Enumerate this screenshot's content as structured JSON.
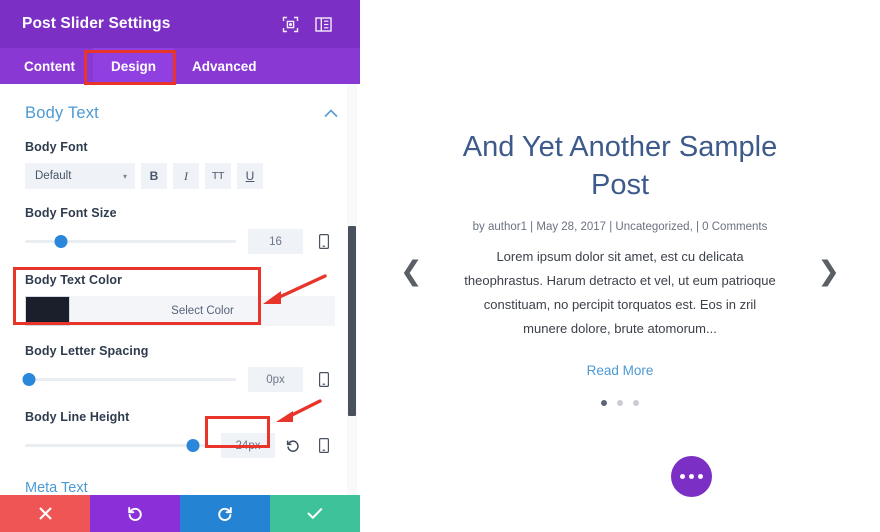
{
  "panel": {
    "title": "Post Slider Settings",
    "header_icons": [
      {
        "name": "focus-target-icon"
      },
      {
        "name": "layout-panel-icon"
      }
    ],
    "tabs": [
      {
        "label": "Content",
        "active": false
      },
      {
        "label": "Design",
        "active": true
      },
      {
        "label": "Advanced",
        "active": false
      }
    ],
    "section": {
      "title": "Body Text",
      "collapse_icon": "chevron-up-icon"
    },
    "fields": {
      "body_font": {
        "label": "Body Font",
        "value": "Default",
        "caret": "▾",
        "style_buttons": [
          "B",
          "I",
          "TT",
          "U"
        ]
      },
      "body_font_size": {
        "label": "Body Font Size",
        "value": "16",
        "knob_percent": 17
      },
      "body_text_color": {
        "label": "Body Text Color",
        "swatch_hex": "#1b1f2c",
        "button_label": "Select Color"
      },
      "body_letter_spacing": {
        "label": "Body Letter Spacing",
        "value": "0px",
        "knob_percent": 2
      },
      "body_line_height": {
        "label": "Body Line Height",
        "value": "24px",
        "knob_percent": 91,
        "reset_icon": "undo-reset-icon"
      }
    },
    "next_section_peek": "Meta Text",
    "action_bar": [
      {
        "name": "close",
        "glyph": "✕"
      },
      {
        "name": "undo",
        "glyph": "↺"
      },
      {
        "name": "redo",
        "glyph": "↻"
      },
      {
        "name": "save",
        "glyph": "✔"
      }
    ],
    "colors": {
      "header": "#7b2fc4",
      "tabbar": "#8a38d4",
      "tab_active": "#9040e0",
      "section_title": "#4c9ad4",
      "slider_knob": "#2b87da",
      "annotation": "#e8342a",
      "act_close": "#f05555",
      "act_undo": "#8b30d9",
      "act_redo": "#2583d4",
      "act_save": "#3ec29a"
    }
  },
  "preview": {
    "post_title": "And Yet Another Sample Post",
    "post_meta": "by author1 | May 28, 2017 | Uncategorized, | 0 Comments",
    "post_excerpt": "Lorem ipsum dolor sit amet, est cu delicata theophrastus. Harum detracto et vel, ut eum patrioque constituam, no percipit torquatos est. Eos in zril munere dolore, brute atomorum...",
    "read_more": "Read More",
    "prev_arrow": "❮",
    "next_arrow": "❯",
    "dots": [
      true,
      false,
      false
    ],
    "fab_icon": "three-dots-icon"
  }
}
